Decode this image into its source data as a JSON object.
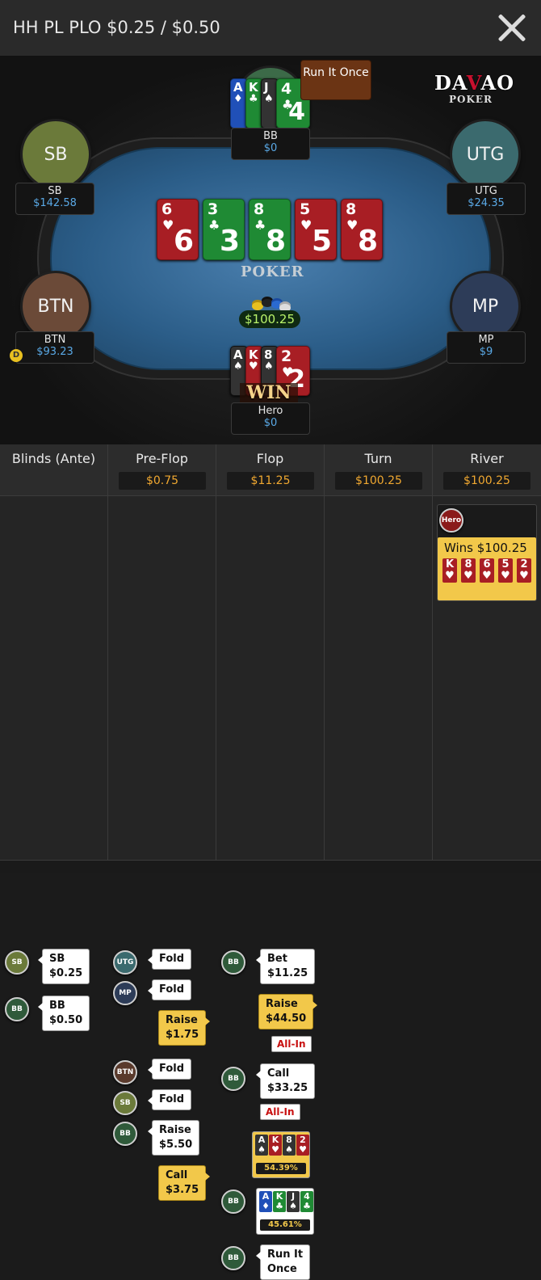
{
  "header": {
    "title": "HH PL PLO $0.25 / $0.50"
  },
  "logo": {
    "top": "DAVAO",
    "sub": "POKER",
    "felt": "POKER"
  },
  "run_it_once_label": "Run It Once",
  "seats": {
    "sb": {
      "label": "SB",
      "name": "SB",
      "stack": "$142.58",
      "color": "#6b7a3a"
    },
    "utg": {
      "label": "UTG",
      "name": "UTG",
      "stack": "$24.35",
      "color": "#3b6a6e"
    },
    "btn": {
      "label": "BTN",
      "name": "BTN",
      "stack": "$93.23",
      "color": "#6b4a38"
    },
    "mp": {
      "label": "MP",
      "name": "MP",
      "stack": "$9",
      "color": "#2d3c58"
    },
    "bb": {
      "name": "BB",
      "stack": "$0",
      "cards": [
        {
          "rank": "A",
          "suit": "♦",
          "color": "blue"
        },
        {
          "rank": "K",
          "suit": "♣",
          "color": "green"
        },
        {
          "rank": "J",
          "suit": "♠",
          "color": "black"
        },
        {
          "rank": "4",
          "suit": "♣",
          "color": "green"
        }
      ]
    },
    "hero": {
      "name": "Hero",
      "stack": "$0",
      "cards": [
        {
          "rank": "A",
          "suit": "♠",
          "color": "black"
        },
        {
          "rank": "K",
          "suit": "♥",
          "color": "red"
        },
        {
          "rank": "8",
          "suit": "♠",
          "color": "black"
        },
        {
          "rank": "2",
          "suit": "♥",
          "color": "red"
        }
      ],
      "badge": "WIN"
    }
  },
  "dealer_button": "D",
  "board": [
    {
      "rank": "6",
      "suit": "♥",
      "color": "red"
    },
    {
      "rank": "3",
      "suit": "♣",
      "color": "green"
    },
    {
      "rank": "8",
      "suit": "♣",
      "color": "green"
    },
    {
      "rank": "5",
      "suit": "♥",
      "color": "red"
    },
    {
      "rank": "8",
      "suit": "♥",
      "color": "red"
    }
  ],
  "pot": "$100.25",
  "history": {
    "columns": [
      {
        "title": "Blinds (Ante)",
        "amount": ""
      },
      {
        "title": "Pre-Flop",
        "amount": "$0.75"
      },
      {
        "title": "Flop",
        "amount": "$11.25"
      },
      {
        "title": "Turn",
        "amount": "$100.25"
      },
      {
        "title": "River",
        "amount": "$100.25"
      }
    ],
    "blinds": [
      {
        "badge": "SB",
        "line1": "SB",
        "line2": "$0.25"
      },
      {
        "badge": "BB",
        "line1": "BB",
        "line2": "$0.50"
      }
    ],
    "preflop": [
      {
        "badge": "UTG",
        "line1": "Fold",
        "line2": ""
      },
      {
        "badge": "MP",
        "line1": "Fold",
        "line2": ""
      },
      {
        "badge": "",
        "line1": "Raise",
        "line2": "$1.75"
      },
      {
        "badge": "BTN",
        "line1": "Fold",
        "line2": ""
      },
      {
        "badge": "SB",
        "line1": "Fold",
        "line2": ""
      },
      {
        "badge": "BB",
        "line1": "Raise",
        "line2": "$5.50"
      },
      {
        "badge": "",
        "line1": "Call",
        "line2": "$3.75"
      }
    ],
    "flop": [
      {
        "badge": "BB",
        "line1": "Bet",
        "line2": "$11.25"
      },
      {
        "badge": "",
        "line1": "Raise",
        "line2": "$44.50",
        "tag": "All-In"
      },
      {
        "badge": "BB",
        "line1": "Call",
        "line2": "$33.25",
        "tag": "All-In"
      },
      {
        "badge": "",
        "equity": "54.39%",
        "cards": [
          {
            "rank": "A",
            "suit": "♠",
            "color": "black"
          },
          {
            "rank": "K",
            "suit": "♥",
            "color": "red"
          },
          {
            "rank": "8",
            "suit": "♠",
            "color": "black"
          },
          {
            "rank": "2",
            "suit": "♥",
            "color": "red"
          }
        ]
      },
      {
        "badge": "BB",
        "equity": "45.61%",
        "cards": [
          {
            "rank": "A",
            "suit": "♦",
            "color": "blue"
          },
          {
            "rank": "K",
            "suit": "♣",
            "color": "green"
          },
          {
            "rank": "J",
            "suit": "♠",
            "color": "black"
          },
          {
            "rank": "4",
            "suit": "♣",
            "color": "green"
          }
        ]
      },
      {
        "badge": "BB",
        "line1": "Run It",
        "line2": "Once"
      }
    ],
    "river": {
      "badge": "Hero",
      "text": "Wins $100.25",
      "cards": [
        {
          "rank": "K",
          "suit": "♥",
          "color": "red"
        },
        {
          "rank": "8",
          "suit": "♥",
          "color": "red"
        },
        {
          "rank": "6",
          "suit": "♥",
          "color": "red"
        },
        {
          "rank": "5",
          "suit": "♥",
          "color": "red"
        },
        {
          "rank": "2",
          "suit": "♥",
          "color": "red"
        }
      ]
    }
  },
  "badge_colors": {
    "SB": "#6b7a3a",
    "BB": "#2f5a3a",
    "UTG": "#3b6a6e",
    "MP": "#2d3c58",
    "BTN": "#5a3a2c",
    "Hero": "#8a1a1a"
  }
}
